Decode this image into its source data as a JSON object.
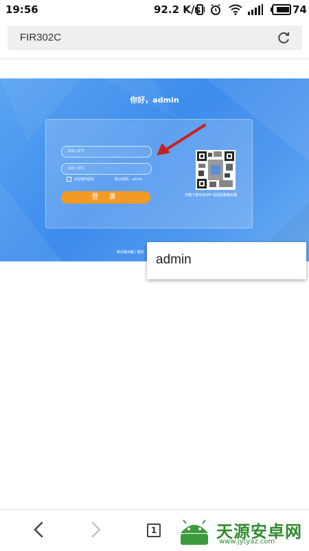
{
  "status_bar": {
    "time": "19:56",
    "net_speed": "92.2 K/s",
    "battery": "74"
  },
  "address_bar": {
    "title": "FIR302C"
  },
  "page": {
    "greeting": "你好，admin",
    "username_placeholder": "请输入账号",
    "password_placeholder": "请输入密码",
    "remember_label": "记住我的密码",
    "default_password": "默认密码：admin",
    "login_label": "登 录",
    "qr_caption": "扫描下载安卓APP 轻松配置路由器",
    "footer": "斐讯路由器 | 服务"
  },
  "autocomplete": {
    "suggestion": "admin"
  },
  "bottom_nav": {
    "tab_count": "1",
    "watermark_text": "天源安卓网",
    "watermark_url": "www.jytyaz.com"
  },
  "colors": {
    "hero_blue": "#4a94ee",
    "login_orange": "#f39a24",
    "annotation_arrow": "#c8201e"
  }
}
